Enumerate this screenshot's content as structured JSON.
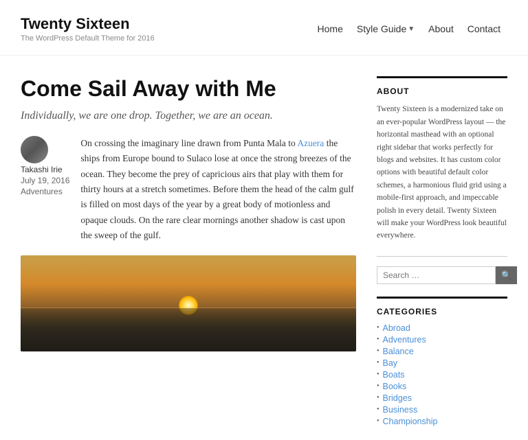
{
  "site": {
    "title": "Twenty Sixteen",
    "description": "The WordPress Default Theme for 2016"
  },
  "nav": {
    "items": [
      {
        "label": "Home",
        "hasDropdown": false
      },
      {
        "label": "Style Guide",
        "hasDropdown": true
      },
      {
        "label": "About",
        "hasDropdown": false
      },
      {
        "label": "Contact",
        "hasDropdown": false
      }
    ]
  },
  "post": {
    "title": "Come Sail Away with Me",
    "subtitle": "Individually, we are one drop. Together, we are an ocean.",
    "author": "Takashi Irie",
    "date": "July 19, 2016",
    "category": "Adventures",
    "body_part1": "On crossing the imaginary line drawn from Punta Mala to ",
    "link_text": "Azuera",
    "body_part2": " the ships from Europe bound to Sulaco lose at once the strong breezes of the ocean. They become the prey of capricious airs that play with them for thirty hours at a stretch sometimes. Before them the head of the calm gulf is filled on most days of the year by a great body of motionless and opaque clouds. On the rare clear mornings another shadow is cast upon the sweep of the gulf."
  },
  "sidebar": {
    "about_title": "ABOUT",
    "about_text": "Twenty Sixteen is a modernized take on an ever-popular WordPress layout — the horizontal masthead with an optional right sidebar that works perfectly for blogs and websites. It has custom color options with beautiful default color schemes, a harmonious fluid grid using a mobile-first approach, and impeccable polish in every detail. Twenty Sixteen will make your WordPress look beautiful everywhere.",
    "search_placeholder": "Search …",
    "search_button_icon": "search",
    "categories_title": "CATEGORIES",
    "categories": [
      {
        "label": "Abroad"
      },
      {
        "label": "Adventures"
      },
      {
        "label": "Balance"
      },
      {
        "label": "Bay"
      },
      {
        "label": "Boats"
      },
      {
        "label": "Books"
      },
      {
        "label": "Bridges"
      },
      {
        "label": "Business"
      },
      {
        "label": "Championship"
      }
    ]
  }
}
